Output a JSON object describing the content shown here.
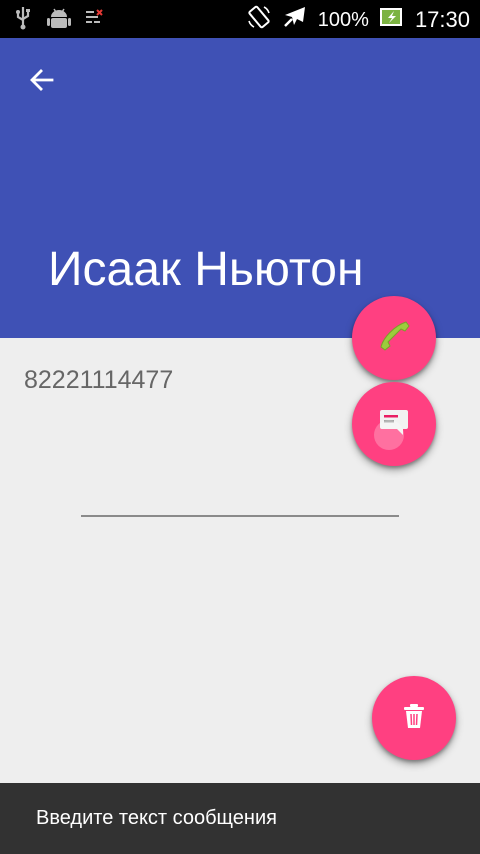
{
  "status_bar": {
    "battery_percent": "100%",
    "time": "17:30",
    "icons": [
      "usb-icon",
      "android-debug-icon",
      "sim-manager-icon",
      "rotate-icon",
      "airplane-icon",
      "battery-charging-icon"
    ]
  },
  "toolbar": {
    "title": "Исаак Ньютон",
    "background_color": "#3f51b5",
    "back_icon": "arrow-back-icon"
  },
  "contact": {
    "phone": "82221114477"
  },
  "fabs": {
    "accent_color": "#ff4081",
    "call_icon": "phone-icon",
    "message_icon": "message-icon",
    "delete_icon": "trash-icon"
  },
  "snackbar": {
    "text": "Введите текст сообщения"
  }
}
